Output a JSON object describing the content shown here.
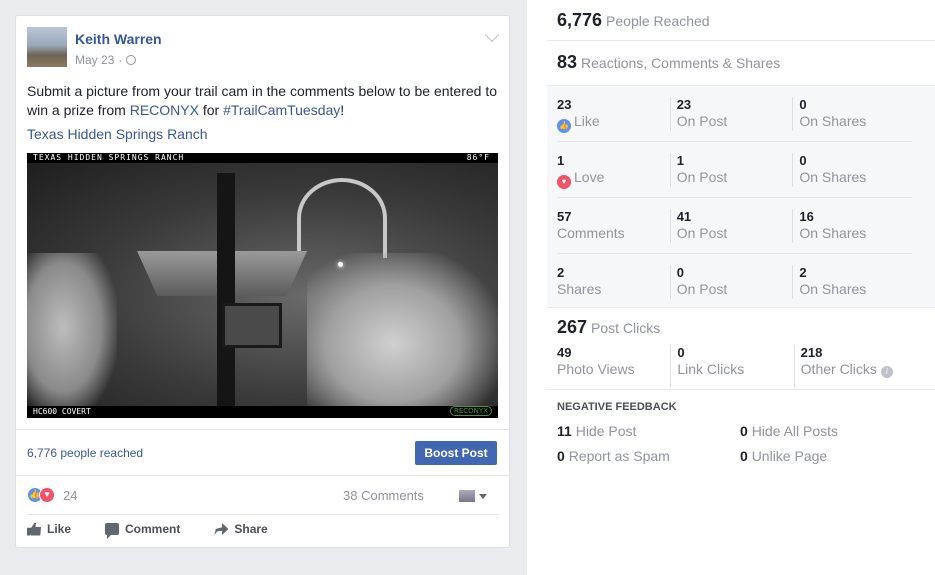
{
  "post": {
    "author": "Keith Warren",
    "date": "May 23",
    "dot": "·",
    "text_before": "Submit a picture from your trail cam in the comments below to be entered to win a prize from ",
    "mention": "RECONYX",
    "text_mid": " for ",
    "hashtag": "#TrailCamTuesday",
    "text_after": "!",
    "location_link": "Texas Hidden Springs Ranch",
    "photo": {
      "top_overlay": "TEXAS HIDDEN SPRINGS RANCH",
      "temp_overlay": "86°F",
      "bottom_overlay": "HC600 COVERT",
      "logo": "RECONYX"
    },
    "reach_text": "6,776 people reached",
    "boost_label": "Boost Post",
    "reaction_count": "24",
    "comments_count": "38 Comments",
    "actions": {
      "like": "Like",
      "comment": "Comment",
      "share": "Share"
    }
  },
  "stats": {
    "people_reached": {
      "value": "6,776",
      "label": "People Reached"
    },
    "engagement": {
      "value": "83",
      "label": "Reactions, Comments & Shares"
    },
    "rows": [
      {
        "total": "23",
        "label": "Like",
        "on_post": "23",
        "on_post_label": "On Post",
        "on_shares": "0",
        "on_shares_label": "On Shares"
      },
      {
        "total": "1",
        "label": "Love",
        "on_post": "1",
        "on_post_label": "On Post",
        "on_shares": "0",
        "on_shares_label": "On Shares"
      },
      {
        "total": "57",
        "label": "Comments",
        "on_post": "41",
        "on_post_label": "On Post",
        "on_shares": "16",
        "on_shares_label": "On Shares"
      },
      {
        "total": "2",
        "label": "Shares",
        "on_post": "0",
        "on_post_label": "On Post",
        "on_shares": "2",
        "on_shares_label": "On Shares"
      }
    ],
    "post_clicks": {
      "value": "267",
      "label": "Post Clicks"
    },
    "clicks": [
      {
        "value": "49",
        "label": "Photo Views"
      },
      {
        "value": "0",
        "label": "Link Clicks"
      },
      {
        "value": "218",
        "label": "Other Clicks"
      }
    ],
    "negative_title": "NEGATIVE FEEDBACK",
    "negative": [
      {
        "value": "11",
        "label": "Hide Post"
      },
      {
        "value": "0",
        "label": "Hide All Posts"
      },
      {
        "value": "0",
        "label": "Report as Spam"
      },
      {
        "value": "0",
        "label": "Unlike Page"
      }
    ]
  },
  "colors": {
    "link": "#365899",
    "button": "#4267b2",
    "like": "#5890ff",
    "love": "#f25268"
  }
}
